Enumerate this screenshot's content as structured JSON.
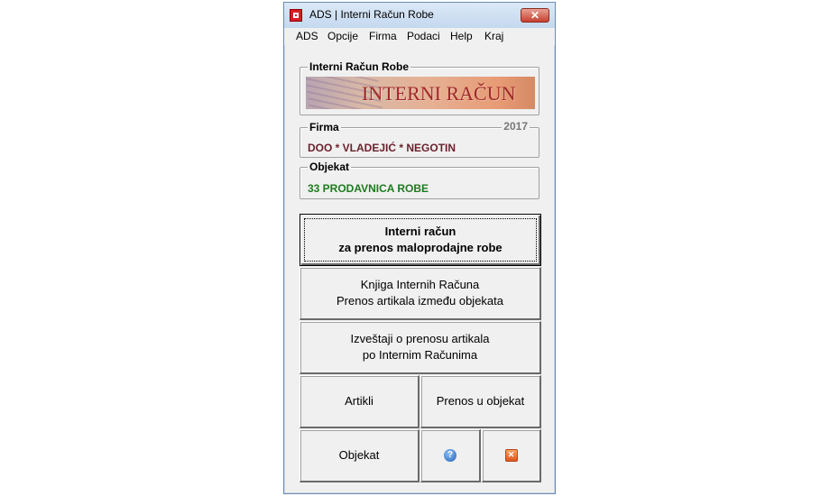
{
  "window": {
    "title": "ADS | Interni Račun Robe",
    "close_symbol": "✕"
  },
  "menu": [
    "ADS",
    "Opcije",
    "Firma",
    "Podaci",
    "Help",
    "Kraj"
  ],
  "header_group": {
    "label": "Interni Račun Robe",
    "banner_text": "INTERNI RAČUN",
    "banner_icon": "invoice-document-image"
  },
  "firma_group": {
    "label": "Firma",
    "year": "2017",
    "value": "DOO * VLADEJIĆ * NEGOTIN"
  },
  "objekat_group": {
    "label": "Objekat",
    "value": "33 PRODAVNICA ROBE"
  },
  "buttons": {
    "interni_racun": {
      "line1": "Interni račun",
      "line2": "za prenos maloprodajne robe"
    },
    "knjiga": {
      "line1": "Knjiga Internih Računa",
      "line2": "Prenos artikala između objekata"
    },
    "izvestaji": {
      "line1": "Izveštaji o prenosu artikala",
      "line2": "po Internim Računima"
    },
    "artikli": "Artikli",
    "prenos": "Prenos u objekat",
    "objekat": "Objekat",
    "help_icon": "help-icon",
    "exit_icon": "exit-icon"
  },
  "colors": {
    "firma_value": "#6b1f2a",
    "objekat_value": "#1f7a1f",
    "banner_text": "#a02828"
  }
}
